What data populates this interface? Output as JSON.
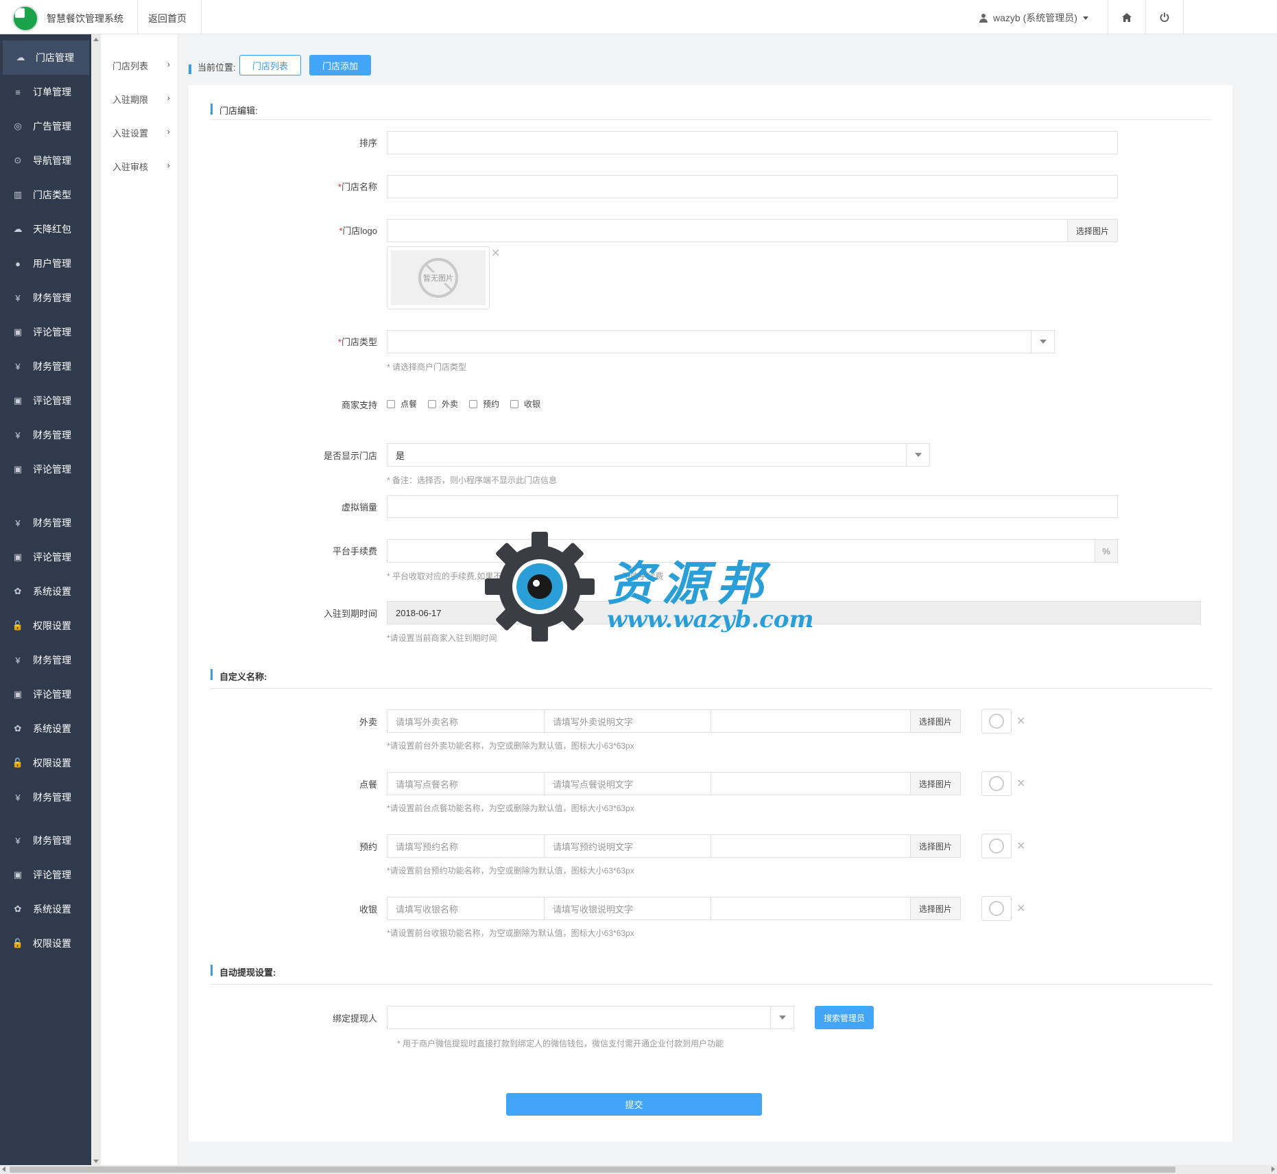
{
  "header": {
    "app_name": "智慧餐饮管理系统",
    "back_home": "返回首页",
    "user": "wazyb (系统管理员)"
  },
  "sidebar": {
    "items": [
      {
        "label": "门店管理",
        "icon": "store-icon"
      },
      {
        "label": "订单管理",
        "icon": "list-icon"
      },
      {
        "label": "广告管理",
        "icon": "globe-icon"
      },
      {
        "label": "导航管理",
        "icon": "compass-icon"
      },
      {
        "label": "门店类型",
        "icon": "bank-icon"
      },
      {
        "label": "天降红包",
        "icon": "store-icon"
      },
      {
        "label": "用户管理",
        "icon": "user-icon"
      },
      {
        "label": "财务管理",
        "icon": "yen-icon"
      },
      {
        "label": "评论管理",
        "icon": "money-icon"
      },
      {
        "label": "财务管理",
        "icon": "yen-icon"
      },
      {
        "label": "评论管理",
        "icon": "money-icon"
      },
      {
        "label": "财务管理",
        "icon": "yen-icon"
      },
      {
        "label": "评论管理",
        "icon": "money-icon"
      },
      {
        "label": "财务管理",
        "icon": "yen-icon"
      },
      {
        "label": "评论管理",
        "icon": "money-icon"
      },
      {
        "label": "系统设置",
        "icon": "gear-icon"
      },
      {
        "label": "权限设置",
        "icon": "lock-icon"
      },
      {
        "label": "财务管理",
        "icon": "yen-icon"
      },
      {
        "label": "评论管理",
        "icon": "money-icon"
      },
      {
        "label": "系统设置",
        "icon": "gear-icon"
      },
      {
        "label": "权限设置",
        "icon": "lock-icon"
      },
      {
        "label": "财务管理",
        "icon": "yen-icon"
      },
      {
        "label": "财务管理",
        "icon": "yen-icon"
      },
      {
        "label": "评论管理",
        "icon": "money-icon"
      },
      {
        "label": "系统设置",
        "icon": "gear-icon"
      },
      {
        "label": "权限设置",
        "icon": "lock-icon"
      }
    ]
  },
  "submenu": {
    "items": [
      "门店列表",
      "入驻期限",
      "入驻设置",
      "入驻审核"
    ]
  },
  "breadcrumb": {
    "label": "当前位置:",
    "btn_list": "门店列表",
    "btn_add": "门店添加"
  },
  "form": {
    "section_edit": "门店编辑:",
    "sort_label": "排序",
    "name_label": "门店名称",
    "logo_label": "门店logo",
    "choose_image": "选择图片",
    "no_image": "暂无图片",
    "type_label": "门店类型",
    "type_hint": "* 请选择商户门店类型",
    "support_label": "商家支持",
    "support_options": [
      "点餐",
      "外卖",
      "预约",
      "收银"
    ],
    "show_label": "是否显示门店",
    "show_value": "是",
    "show_hint": "* 备注：选择否，则小程序端不显示此门店信息",
    "virtual_sales_label": "虚拟销量",
    "fee_label": "平台手续费",
    "fee_addon": "%",
    "fee_hint": "* 平台收取对应的手续费,如果不填则收",
    "fee_hint_tail": "下的手续费",
    "expire_label": "入驻到期时间",
    "expire_value": "2018-06-17",
    "expire_hint": "*请设置当前商家入驻到期时间",
    "section_custom": "自定义名称:",
    "custom_rows": [
      {
        "label": "外卖",
        "name_ph": "请填写外卖名称",
        "desc_ph": "请填写外卖说明文字",
        "btn": "选择图片",
        "hint": "*请设置前台外卖功能名称，为空或删除为默认值，图标大小63*63px"
      },
      {
        "label": "点餐",
        "name_ph": "请填写点餐名称",
        "desc_ph": "请填写点餐说明文字",
        "btn": "选择图片",
        "hint": "*请设置前台点餐功能名称，为空或删除为默认值，图标大小63*63px"
      },
      {
        "label": "预约",
        "name_ph": "请填写预约名称",
        "desc_ph": "请填写预约说明文字",
        "btn": "选择图片",
        "hint": "*请设置前台预约功能名称，为空或删除为默认值，图标大小63*63px"
      },
      {
        "label": "收银",
        "name_ph": "请填写收银名称",
        "desc_ph": "请填写收银说明文字",
        "btn": "选择图片",
        "hint": "*请设置前台收银功能名称，为空或删除为默认值，图标大小63*63px"
      }
    ],
    "section_withdraw": "自动提现设置:",
    "bind_label": "绑定提现人",
    "search_admin": "搜索管理员",
    "bind_hint": "* 用于商户微信提现时直接打款到绑定人的微信钱包，微信支付需开通企业付款到用户功能",
    "submit": "提交"
  },
  "watermark": {
    "title": "资源邦",
    "url": "www.wazyb.com"
  },
  "colors": {
    "accent": "#42a5f5",
    "sidebar_bg": "#2f3a4c",
    "required": "#e22233"
  }
}
